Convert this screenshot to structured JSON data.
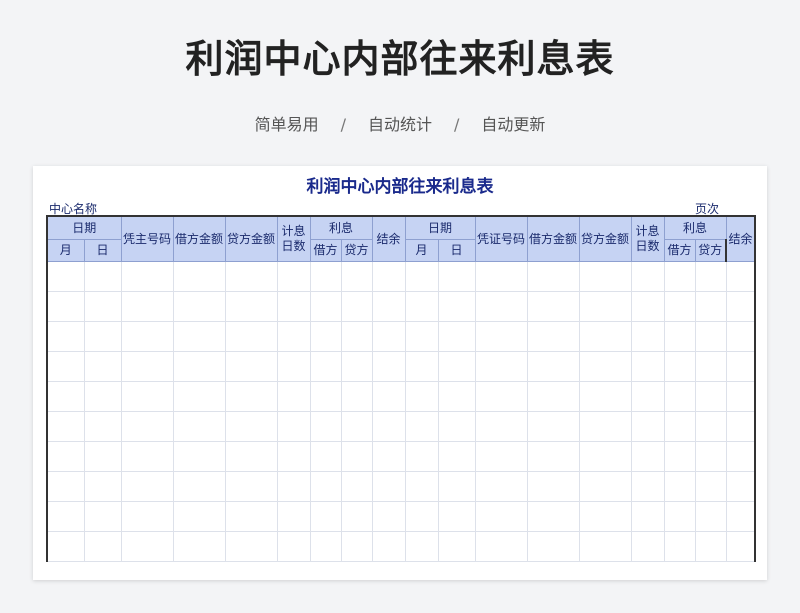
{
  "hero": {
    "title": "利润中心内部往来利息表",
    "features": [
      "简单易用",
      "自动统计",
      "自动更新"
    ],
    "separator": "/"
  },
  "sheet": {
    "title": "利润中心内部往来利息表",
    "left_label": "中心名称",
    "right_label": "页次"
  },
  "table": {
    "left": {
      "date": "日期",
      "month": "月",
      "day": "日",
      "voucher": "凭主号码",
      "debit_amount": "借方金额",
      "credit_amount": "贷方金额",
      "interest_days": "计息日数",
      "interest": "利息",
      "interest_debit": "借方",
      "interest_credit": "贷方",
      "balance": "结余"
    },
    "right": {
      "date": "日期",
      "month": "月",
      "day": "日",
      "voucher": "凭证号码",
      "debit_amount": "借方金额",
      "credit_amount": "贷方金额",
      "interest_days": "计息日数",
      "interest": "利息",
      "interest_debit": "借方",
      "interest_credit": "贷方",
      "balance": "结余"
    },
    "blank_rows": 10
  },
  "colors": {
    "header_fill": "#c6d3f3",
    "sheet_title": "#1a2a8c",
    "background": "#f3f4f6"
  }
}
